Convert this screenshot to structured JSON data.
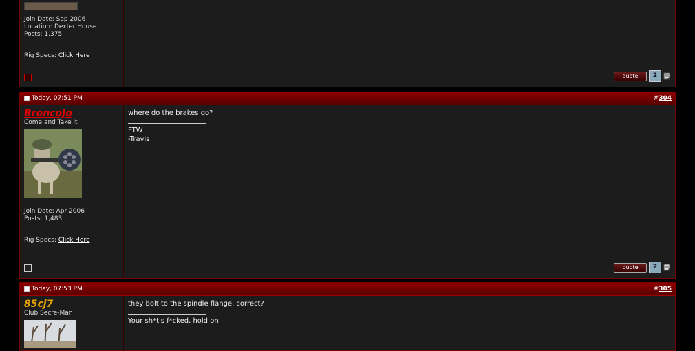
{
  "post_top": {
    "join_date": "Join Date: Sep 2006",
    "location": "Location: Dexter House",
    "posts": "Posts: 1,375",
    "rig_label": "Rig Specs: ",
    "rig_link": "Click Here",
    "quote_label": "quote",
    "multiquote_label": "2"
  },
  "post_304": {
    "date": "Today, 07:51 PM",
    "number_prefix": "#",
    "number": "304",
    "username": "BroncoJo",
    "username_color": "#d80000",
    "user_title": "Come and Take it",
    "join_date": "Join Date: Apr 2006",
    "posts": "Posts: 1,483",
    "rig_label": "Rig Specs: ",
    "rig_link": "Click Here",
    "message": "where do the brakes go?",
    "signature_line1": "FTW",
    "signature_line2": "-Travis",
    "quote_label": "quote",
    "multiquote_label": "2"
  },
  "post_305": {
    "date": "Today, 07:53 PM",
    "number_prefix": "#",
    "number": "305",
    "username": "85cj7",
    "username_color": "#e0a000",
    "user_title": "Club Secre-Man",
    "message": "they bolt to the spindle flange, correct?",
    "signature_line1": "Your sh*t's f*cked, hold on"
  }
}
